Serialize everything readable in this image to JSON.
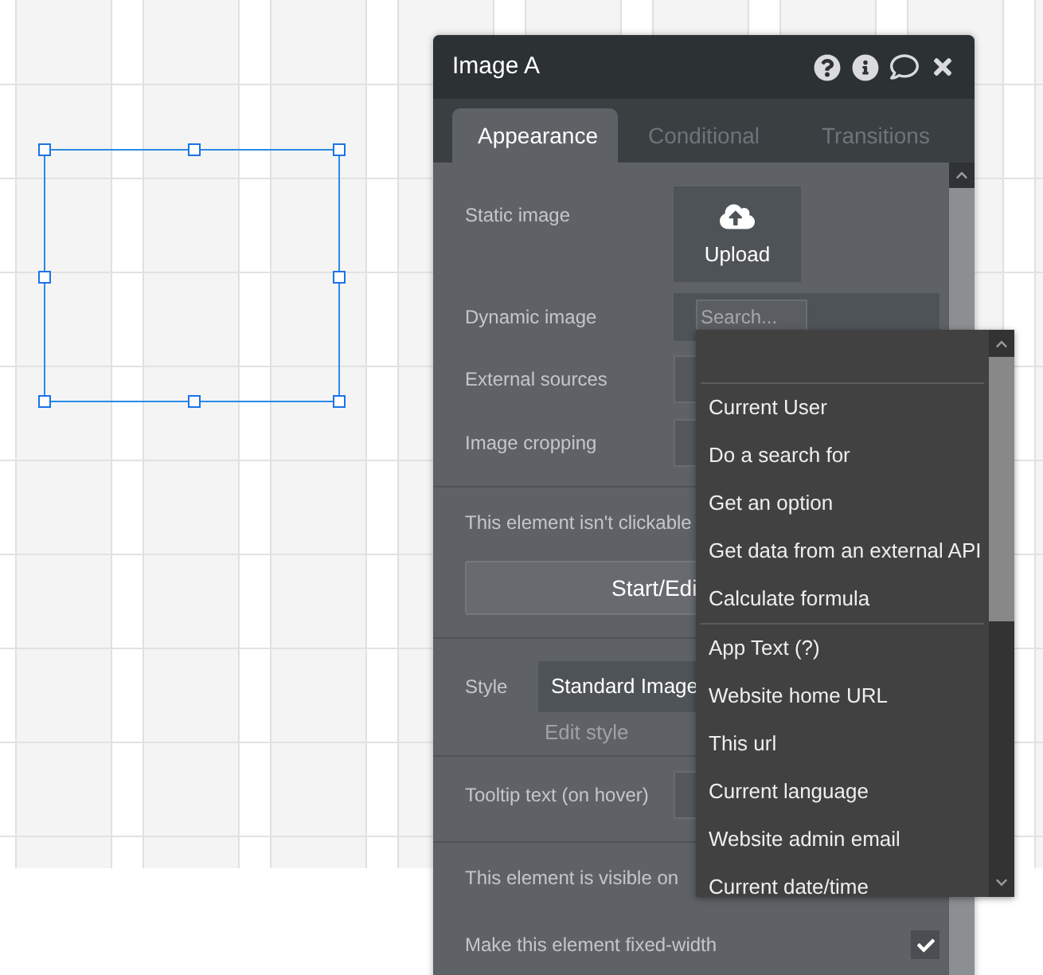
{
  "panel": {
    "title": "Image A",
    "tabs": [
      {
        "label": "Appearance",
        "selected": true
      },
      {
        "label": "Conditional",
        "selected": false
      },
      {
        "label": "Transitions",
        "selected": false
      }
    ],
    "static_image": {
      "label": "Static image",
      "button": "Upload"
    },
    "dynamic_image": {
      "label": "Dynamic image",
      "placeholder": "Search..."
    },
    "external_sources": {
      "label": "External sources"
    },
    "image_cropping": {
      "label": "Image cropping"
    },
    "clickable_note": "This element isn't clickable",
    "workflow_button": "Start/Edi",
    "style": {
      "label": "Style",
      "value": "Standard Image",
      "edit_link": "Edit style"
    },
    "tooltip": {
      "label": "Tooltip text (on hover)"
    },
    "visible_note": "This element is visible on",
    "fixed_width": {
      "label": "Make this element fixed-width",
      "checked": true
    }
  },
  "dropdown": {
    "sections": [
      {
        "items": [
          "Current User",
          "Do a search for",
          "Get an option",
          "Get data from an external API",
          "Calculate formula"
        ]
      },
      {
        "items": [
          "App Text (?)",
          "Website home URL",
          "This url",
          "Current language",
          "Website admin email",
          "Current date/time"
        ]
      }
    ]
  }
}
